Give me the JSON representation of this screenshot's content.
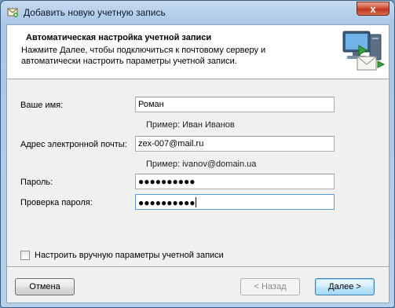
{
  "window": {
    "title": "Добавить новую учетную запись",
    "close_glyph": "x"
  },
  "header": {
    "title": "Автоматическая настройка учетной записи",
    "description": "Нажмите Далее, чтобы подключиться к почтовому серверу и автоматически настроить параметры учетной записи.",
    "graphic_icon": "computer-mail-icon"
  },
  "form": {
    "name_label": "Ваше имя:",
    "name_value": "Роман",
    "name_example": "Пример: Иван Иванов",
    "email_label": "Адрес электронной почты:",
    "email_value": "zex-007@mail.ru",
    "email_example": "Пример: ivanov@domain.ua",
    "password_label": "Пароль:",
    "password_mask": "●●●●●●●●●●",
    "confirm_label": "Проверка пароля:",
    "confirm_mask": "●●●●●●●●●●"
  },
  "manual_setup": {
    "label": "Настроить вручную параметры учетной записи",
    "checked": false
  },
  "buttons": {
    "cancel": "Отмена",
    "back": "< Назад",
    "next": "Далее >"
  },
  "colors": {
    "frame": "#a9c6e6",
    "close_button": "#c03420",
    "focus_border": "#569de5",
    "default_button": "#3c7fb1"
  }
}
